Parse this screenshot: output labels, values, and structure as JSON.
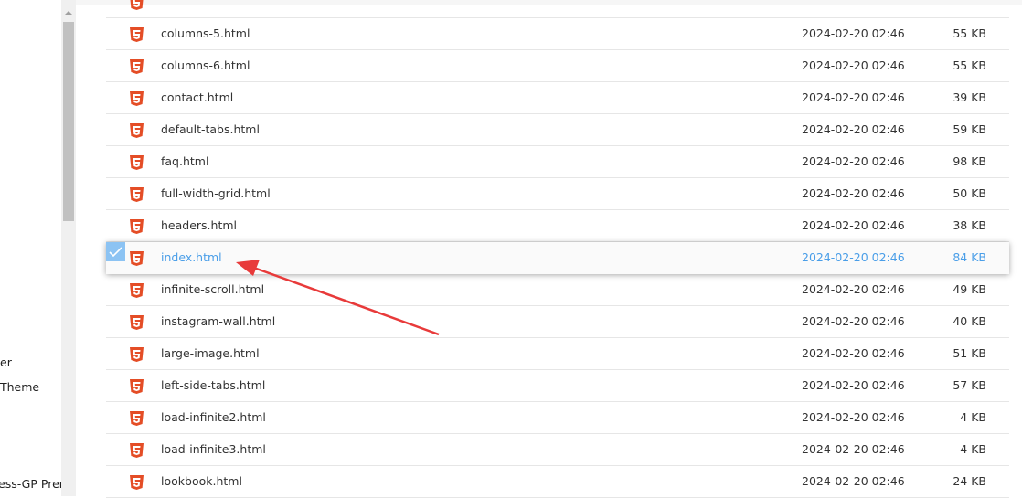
{
  "sidebar_fragments": [
    "er",
    "Theme",
    "ess-GP Prem"
  ],
  "files": [
    {
      "name": "",
      "date": "",
      "size": ""
    },
    {
      "name": "columns-5.html",
      "date": "2024-02-20 02:46",
      "size": "55 KB"
    },
    {
      "name": "columns-6.html",
      "date": "2024-02-20 02:46",
      "size": "55 KB"
    },
    {
      "name": "contact.html",
      "date": "2024-02-20 02:46",
      "size": "39 KB"
    },
    {
      "name": "default-tabs.html",
      "date": "2024-02-20 02:46",
      "size": "59 KB"
    },
    {
      "name": "faq.html",
      "date": "2024-02-20 02:46",
      "size": "98 KB"
    },
    {
      "name": "full-width-grid.html",
      "date": "2024-02-20 02:46",
      "size": "50 KB"
    },
    {
      "name": "headers.html",
      "date": "2024-02-20 02:46",
      "size": "38 KB"
    },
    {
      "name": "index.html",
      "date": "2024-02-20 02:46",
      "size": "84 KB",
      "selected": true
    },
    {
      "name": "infinite-scroll.html",
      "date": "2024-02-20 02:46",
      "size": "49 KB"
    },
    {
      "name": "instagram-wall.html",
      "date": "2024-02-20 02:46",
      "size": "40 KB"
    },
    {
      "name": "large-image.html",
      "date": "2024-02-20 02:46",
      "size": "51 KB"
    },
    {
      "name": "left-side-tabs.html",
      "date": "2024-02-20 02:46",
      "size": "57 KB"
    },
    {
      "name": "load-infinite2.html",
      "date": "2024-02-20 02:46",
      "size": "4 KB"
    },
    {
      "name": "load-infinite3.html",
      "date": "2024-02-20 02:46",
      "size": "4 KB"
    },
    {
      "name": "lookbook.html",
      "date": "2024-02-20 02:46",
      "size": "24 KB"
    }
  ],
  "icons": {
    "file": "html5-icon",
    "check": "checkmark-icon"
  },
  "colors": {
    "html5": "#e44d26",
    "selected_text": "#4a9ee8",
    "checkbox": "#8cc3f3",
    "arrow": "#e83a3a"
  }
}
